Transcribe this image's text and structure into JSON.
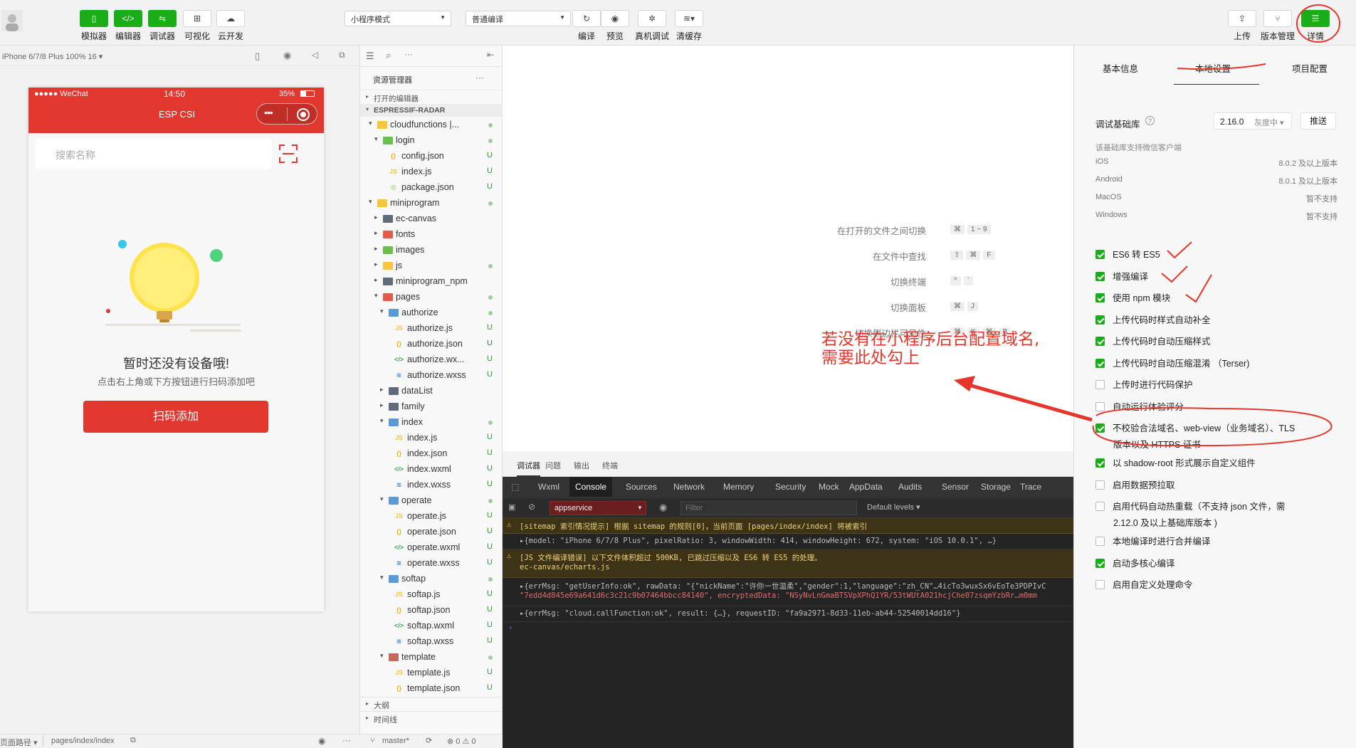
{
  "toolbar": {
    "buttons_left": [
      {
        "label": "模拟器",
        "icon": "phone-icon"
      },
      {
        "label": "编辑器",
        "icon": "code-icon"
      },
      {
        "label": "调试器",
        "icon": "debug-icon"
      },
      {
        "label": "可视化",
        "icon": "layout-icon"
      },
      {
        "label": "云开发",
        "icon": "cloud-icon"
      }
    ],
    "mode_select": "小程序模式",
    "compile_select": "普通编译",
    "buttons_mid": [
      {
        "label": "编译",
        "icon": "refresh-icon"
      },
      {
        "label": "预览",
        "icon": "eye-icon"
      },
      {
        "label": "真机调试",
        "icon": "bug-icon"
      },
      {
        "label": "清缓存",
        "icon": "layers-icon"
      }
    ],
    "buttons_right": [
      {
        "label": "上传",
        "icon": "upload-icon"
      },
      {
        "label": "版本管理",
        "icon": "branch-icon"
      },
      {
        "label": "详情",
        "icon": "menu-icon"
      }
    ]
  },
  "simulator": {
    "device_label": "iPhone 6/7/8 Plus 100% 16 ▾",
    "status_left": "●●●●● WeChat",
    "status_time": "14:50",
    "status_battery": "35%",
    "nav_title": "ESP CSI",
    "search_placeholder": "搜索名称",
    "empty_title": "暂时还没有设备哦!",
    "empty_subtitle": "点击右上角或下方按钮进行扫码添加吧",
    "scan_button": "扫码添加"
  },
  "explorer": {
    "title": "资源管理器",
    "open_editors": "打开的编辑器",
    "project": "ESPRESSIF-RADAR",
    "outline": "大纲",
    "timeline": "时间线",
    "rows": [
      {
        "label": "cloudfunctions |...",
        "type": "folder-cloud",
        "indent": 1,
        "arrow": "▾",
        "status": "dot"
      },
      {
        "label": "login",
        "type": "folder-green",
        "indent": 2,
        "arrow": "▾",
        "status": "dot"
      },
      {
        "label": "config.json",
        "type": "json",
        "indent": 3,
        "arrow": "",
        "status": "U"
      },
      {
        "label": "index.js",
        "type": "js",
        "indent": 3,
        "arrow": "",
        "status": "U"
      },
      {
        "label": "package.json",
        "type": "pkg",
        "indent": 3,
        "arrow": "",
        "status": "U"
      },
      {
        "label": "miniprogram",
        "type": "folder",
        "indent": 1,
        "arrow": "▾",
        "status": "dot"
      },
      {
        "label": "ec-canvas",
        "type": "folder-dark",
        "indent": 2,
        "arrow": "▸",
        "status": ""
      },
      {
        "label": "fonts",
        "type": "folder-red",
        "indent": 2,
        "arrow": "▸",
        "status": ""
      },
      {
        "label": "images",
        "type": "folder-green",
        "indent": 2,
        "arrow": "▸",
        "status": ""
      },
      {
        "label": "js",
        "type": "folder",
        "indent": 2,
        "arrow": "▸",
        "status": "dot"
      },
      {
        "label": "miniprogram_npm",
        "type": "folder-dark",
        "indent": 2,
        "arrow": "▸",
        "status": ""
      },
      {
        "label": "pages",
        "type": "folder-red",
        "indent": 2,
        "arrow": "▾",
        "status": "dot"
      },
      {
        "label": "authorize",
        "type": "folder-blue",
        "indent": 3,
        "arrow": "▾",
        "status": "dot"
      },
      {
        "label": "authorize.js",
        "type": "js",
        "indent": 4,
        "arrow": "",
        "status": "U"
      },
      {
        "label": "authorize.json",
        "type": "json",
        "indent": 4,
        "arrow": "",
        "status": "U"
      },
      {
        "label": "authorize.wx...",
        "type": "wxml",
        "indent": 4,
        "arrow": "",
        "status": "U"
      },
      {
        "label": "authorize.wxss",
        "type": "wxss",
        "indent": 4,
        "arrow": "",
        "status": "U"
      },
      {
        "label": "dataList",
        "type": "folder-dark",
        "indent": 3,
        "arrow": "▸",
        "status": ""
      },
      {
        "label": "family",
        "type": "folder-dark",
        "indent": 3,
        "arrow": "▸",
        "status": ""
      },
      {
        "label": "index",
        "type": "folder-blue",
        "indent": 3,
        "arrow": "▾",
        "status": "dot"
      },
      {
        "label": "index.js",
        "type": "js",
        "indent": 4,
        "arrow": "",
        "status": "U"
      },
      {
        "label": "index.json",
        "type": "json",
        "indent": 4,
        "arrow": "",
        "status": "U"
      },
      {
        "label": "index.wxml",
        "type": "wxml",
        "indent": 4,
        "arrow": "",
        "status": "U"
      },
      {
        "label": "index.wxss",
        "type": "wxss",
        "indent": 4,
        "arrow": "",
        "status": "U"
      },
      {
        "label": "operate",
        "type": "folder-blue",
        "indent": 3,
        "arrow": "▾",
        "status": "dot"
      },
      {
        "label": "operate.js",
        "type": "js",
        "indent": 4,
        "arrow": "",
        "status": "U"
      },
      {
        "label": "operate.json",
        "type": "json",
        "indent": 4,
        "arrow": "",
        "status": "U"
      },
      {
        "label": "operate.wxml",
        "type": "wxml",
        "indent": 4,
        "arrow": "",
        "status": "U"
      },
      {
        "label": "operate.wxss",
        "type": "wxss",
        "indent": 4,
        "arrow": "",
        "status": "U"
      },
      {
        "label": "softap",
        "type": "folder-blue",
        "indent": 3,
        "arrow": "▾",
        "status": "dot"
      },
      {
        "label": "softap.js",
        "type": "js",
        "indent": 4,
        "arrow": "",
        "status": "U"
      },
      {
        "label": "softap.json",
        "type": "json",
        "indent": 4,
        "arrow": "",
        "status": "U"
      },
      {
        "label": "softap.wxml",
        "type": "wxml",
        "indent": 4,
        "arrow": "",
        "status": "U"
      },
      {
        "label": "softap.wxss",
        "type": "wxss",
        "indent": 4,
        "arrow": "",
        "status": "U"
      },
      {
        "label": "template",
        "type": "folder-brown",
        "indent": 3,
        "arrow": "▾",
        "status": "dot"
      },
      {
        "label": "template.js",
        "type": "js",
        "indent": 4,
        "arrow": "",
        "status": "U"
      },
      {
        "label": "template.json",
        "type": "json",
        "indent": 4,
        "arrow": "",
        "status": "U"
      }
    ]
  },
  "editor": {
    "shortcuts": [
      {
        "label": "在打开的文件之间切换",
        "keys": [
          "⌘",
          "1 ~ 9"
        ]
      },
      {
        "label": "在文件中查找",
        "keys": [
          "⇧",
          "⌘",
          "F"
        ]
      },
      {
        "label": "切换终端",
        "keys": [
          "^",
          "`"
        ]
      },
      {
        "label": "切换面板",
        "keys": [
          "⌘",
          "J"
        ]
      },
      {
        "label": "切换侧边栏可见性",
        "keys": [
          "⌘",
          "K",
          "⌘",
          "B"
        ]
      }
    ]
  },
  "console": {
    "panel_tabs": [
      "调试器",
      "问题",
      "输出",
      "终端"
    ],
    "devtools_tabs": [
      "Wxml",
      "Console",
      "Sources",
      "Network",
      "Memory",
      "Security",
      "Mock",
      "AppData",
      "Audits",
      "Sensor",
      "Storage",
      "Trace"
    ],
    "context_select": "appservice",
    "filter_placeholder": "Filter",
    "levels": "Default levels ▾",
    "logs": [
      {
        "kind": "warn",
        "text": "[sitemap 索引情况提示] 根据 sitemap 的规则[0]，当前页面 [pages/index/index] 将被索引"
      },
      {
        "kind": "obj",
        "text": "▸{model: \"iPhone 6/7/8 Plus\", pixelRatio: 3, windowWidth: 414, windowHeight: 672, system: \"iOS 10.0.1\", …}"
      },
      {
        "kind": "warn2",
        "text": "[JS 文件编译错误] 以下文件体积超过 500KB, 已跳过压缩以及 ES6 转 ES5 的处理。",
        "text2": "ec-canvas/echarts.js"
      },
      {
        "kind": "obj2",
        "text": "▸{errMsg: \"getUserInfo:ok\", rawData: \"{\"nickName\":\"许你一世温柔\",\"gender\":1,\"language\":\"zh_CN\"…4icTo3wuxSx6vEoTe3PDPIvC",
        "text2": "\"7edd4d845e69a641d6c3c21c9b07464bbcc84140\", encryptedData: \"NSyNvLnGmaBTSVpXPhQ1YR/53tWUtA021hcjChe07zsqmYzbRr…m0mm"
      },
      {
        "kind": "obj",
        "text": "▸{errMsg: \"cloud.callFunction:ok\", result: {…}, requestID: \"fa9a2971-8d33-11eb-ab44-52540014dd16\"}"
      }
    ]
  },
  "details": {
    "tabs": [
      "基本信息",
      "本地设置",
      "项目配置"
    ],
    "lib_label": "调试基础库",
    "lib_version": "2.16.0",
    "lib_gray": "灰度中 ▾",
    "push_button": "推送",
    "support_note": "该基础库支持微信客户端",
    "platforms": [
      {
        "name": "iOS",
        "value": "8.0.2 及以上版本"
      },
      {
        "name": "Android",
        "value": "8.0.1 及以上版本"
      },
      {
        "name": "MacOS",
        "value": "暂不支持"
      },
      {
        "name": "Windows",
        "value": "暂不支持"
      }
    ],
    "options": [
      {
        "label": "ES6 转 ES5",
        "checked": true
      },
      {
        "label": "增强编译",
        "checked": true
      },
      {
        "label": "使用 npm 模块",
        "checked": true
      },
      {
        "label": "上传代码时样式自动补全",
        "checked": true
      },
      {
        "label": "上传代码时自动压缩样式",
        "checked": true
      },
      {
        "label": "上传代码时自动压缩混淆 （Terser)",
        "checked": true
      },
      {
        "label": "上传时进行代码保护",
        "checked": false
      },
      {
        "label": "自动运行体验评分",
        "checked": false
      },
      {
        "label": "不校验合法域名、web-view（业务域名）、TLS",
        "label2": "版本以及 HTTPS 证书",
        "checked": true
      },
      {
        "label": "以 shadow-root 形式展示自定义组件",
        "checked": true
      },
      {
        "label": "启用数据预拉取",
        "checked": false
      },
      {
        "label": "启用代码自动热重载（不支持 json 文件，需",
        "label2": "2.12.0 及以上基础库版本 )",
        "checked": false
      },
      {
        "label": "本地编译时进行合并编译",
        "checked": false
      },
      {
        "label": "启动多核心编译",
        "checked": true
      },
      {
        "label": "启用自定义处理命令",
        "checked": false
      }
    ]
  },
  "statusbar": {
    "page_path_label": "页面路径 ▾",
    "page_path": "pages/index/index",
    "branch": "master*",
    "problems": "⊗ 0 ⚠ 0"
  },
  "annotation": {
    "line1": "若没有在小程序后台配置域名,",
    "line2": "需要此处勾上"
  },
  "colors": {
    "accent_green": "#1aad19",
    "brand_red": "#e2372e",
    "annotation_red": "#e8352b"
  }
}
